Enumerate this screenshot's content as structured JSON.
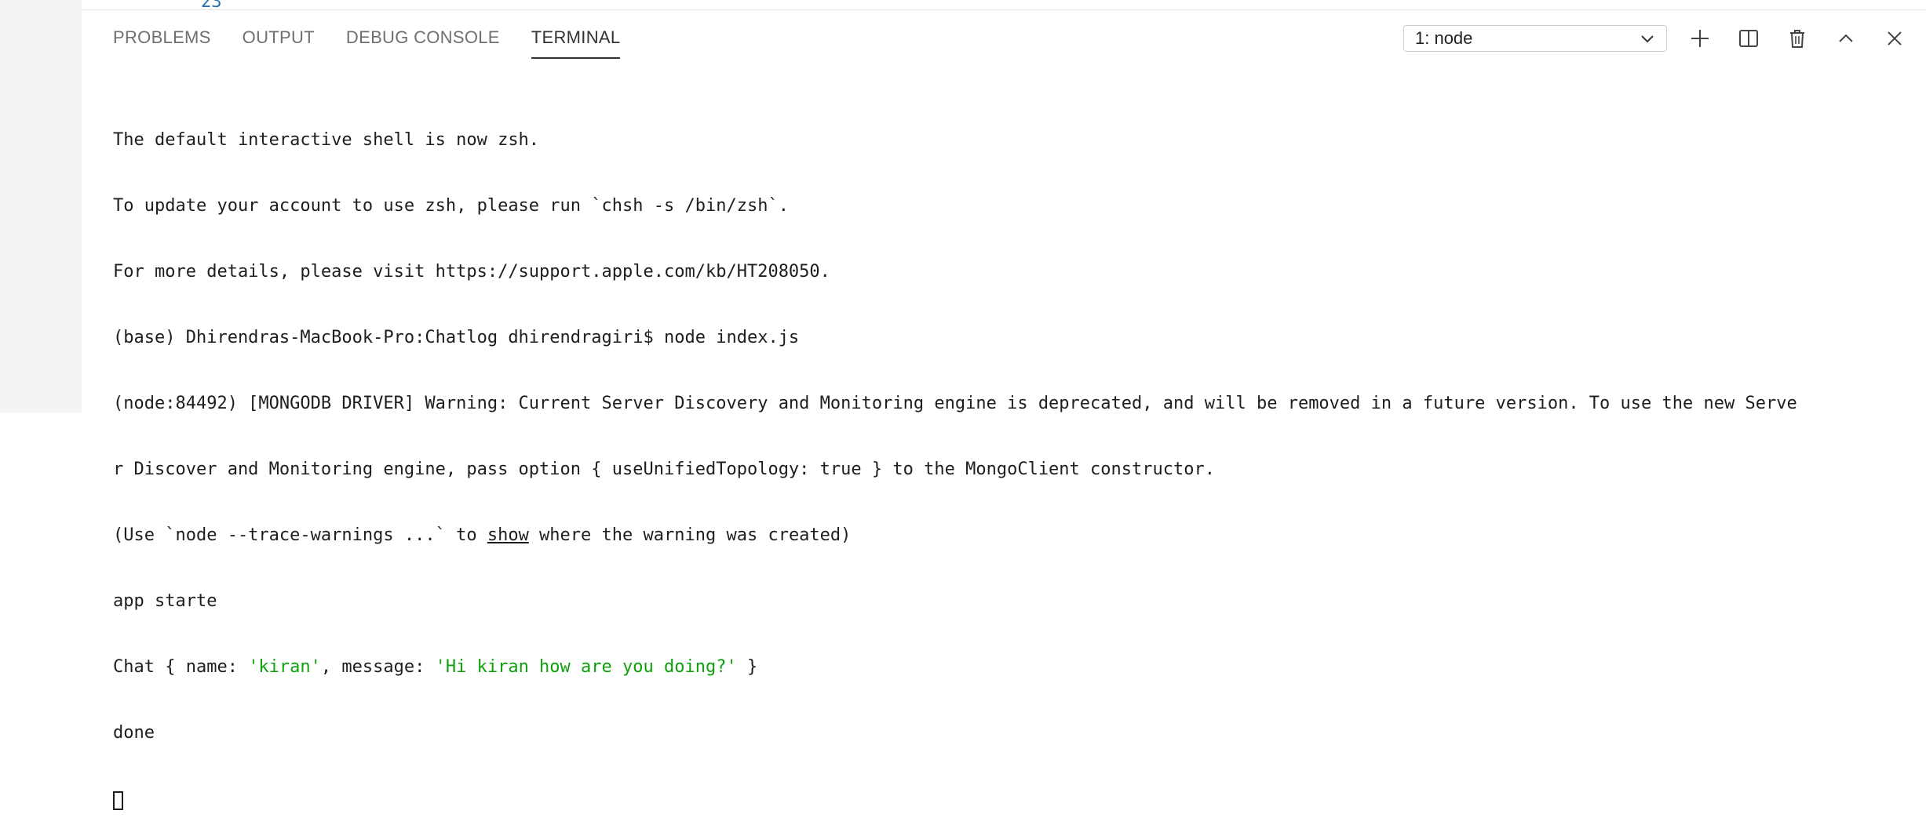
{
  "editor": {
    "line_number": "23"
  },
  "panel": {
    "tabs": [
      {
        "label": "PROBLEMS",
        "active": false
      },
      {
        "label": "OUTPUT",
        "active": false
      },
      {
        "label": "DEBUG CONSOLE",
        "active": false
      },
      {
        "label": "TERMINAL",
        "active": true
      }
    ],
    "terminal_select": {
      "value": "1: node"
    }
  },
  "icons": [
    "plus-icon",
    "split-icon",
    "trash-icon",
    "chevron-up-icon",
    "close-icon",
    "chevron-down-icon"
  ],
  "terminal": {
    "line1": "The default interactive shell is now zsh.",
    "line2": "To update your account to use zsh, please run `chsh -s /bin/zsh`.",
    "line3": "For more details, please visit https://support.apple.com/kb/HT208050.",
    "line4": "(base) Dhirendras-MacBook-Pro:Chatlog dhirendragiri$ node index.js",
    "line5": "(node:84492) [MONGODB DRIVER] Warning: Current Server Discovery and Monitoring engine is deprecated, and will be removed in a future version. To use the new Serve",
    "line6": "r Discover and Monitoring engine, pass option { useUnifiedTopology: true } to the MongoClient constructor.",
    "line7_pre": "(Use `node --trace-warnings ...` to ",
    "line7_link": "show",
    "line7_post": " where the warning was created)",
    "line8": "app starte",
    "line9_pre": "Chat { name: ",
    "line9_name": "'kiran'",
    "line9_mid": ", message: ",
    "line9_msg": "'Hi kiran how are you doing?'",
    "line9_post": " }",
    "line10": "done"
  },
  "colors": {
    "string": "#0da10d",
    "text": "#1e1e1e",
    "tab_inactive": "#6f6f6f"
  }
}
